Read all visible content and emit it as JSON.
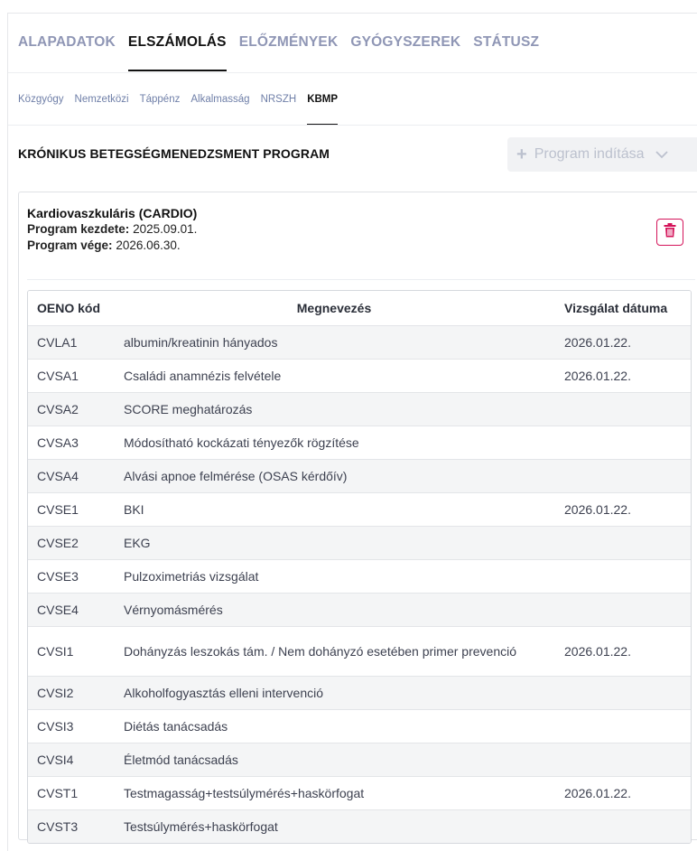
{
  "main_tabs": [
    {
      "label": "ALAPADATOK"
    },
    {
      "label": "ELSZÁMOLÁS"
    },
    {
      "label": "ELŐZMÉNYEK"
    },
    {
      "label": "GYÓGYSZEREK"
    },
    {
      "label": "STÁTUSZ"
    }
  ],
  "sub_tabs": [
    {
      "label": "Közgyógy"
    },
    {
      "label": "Nemzetközi"
    },
    {
      "label": "Táppénz"
    },
    {
      "label": "Alkalmasság"
    },
    {
      "label": "NRSZH"
    },
    {
      "label": "KBMP"
    }
  ],
  "section": {
    "title": "KRÓNIKUS BETEGSÉGMENEDZSMENT PROGRAM",
    "start_button": "Program indítása",
    "start_icon": "plus-icon",
    "dropdown_icon": "chevron-down-icon"
  },
  "program": {
    "name": "Kardiovaszkuláris (CARDIO)",
    "start_label": "Program kezdete:",
    "start_value": "2025.09.01.",
    "end_label": "Program vége:",
    "end_value": "2026.06.30.",
    "delete_icon": "trash-icon"
  },
  "table": {
    "headers": [
      "OENO kód",
      "Megnevezés",
      "Vizsgálat dátuma"
    ],
    "rows": [
      {
        "code": "CVLA1",
        "name": "albumin/kreatinin hányados",
        "date": "2026.01.22."
      },
      {
        "code": "CVSA1",
        "name": "Családi anamnézis felvétele",
        "date": "2026.01.22."
      },
      {
        "code": "CVSA2",
        "name": "SCORE meghatározás",
        "date": ""
      },
      {
        "code": "CVSA3",
        "name": "Módosítható kockázati tényezők rögzítése",
        "date": ""
      },
      {
        "code": "CVSA4",
        "name": "Alvási apnoe felmérése (OSAS kérdőív)",
        "date": ""
      },
      {
        "code": "CVSE1",
        "name": "BKI",
        "date": "2026.01.22."
      },
      {
        "code": "CVSE2",
        "name": "EKG",
        "date": ""
      },
      {
        "code": "CVSE3",
        "name": "Pulzoximetriás vizsgálat",
        "date": ""
      },
      {
        "code": "CVSE4",
        "name": "Vérnyomásmérés",
        "date": ""
      },
      {
        "code": "CVSI1",
        "name": "Dohányzás leszokás tám. / Nem dohányzó esetében primer prevenció",
        "date": "2026.01.22."
      },
      {
        "code": "CVSI2",
        "name": "Alkoholfogyasztás elleni intervenció",
        "date": ""
      },
      {
        "code": "CVSI3",
        "name": "Diétás tanácsadás",
        "date": ""
      },
      {
        "code": "CVSI4",
        "name": "Életmód tanácsadás",
        "date": ""
      },
      {
        "code": "CVST1",
        "name": "Testmagasság+testsúlymérés+haskörfogat",
        "date": "2026.01.22."
      },
      {
        "code": "CVST3",
        "name": "Testsúlymérés+haskörfogat",
        "date": ""
      }
    ]
  },
  "colors": {
    "tab_inactive": "#8f96b5",
    "tab_active": "#111111",
    "delete_accent": "#d4145a",
    "row_stripe": "#f4f5f6"
  }
}
